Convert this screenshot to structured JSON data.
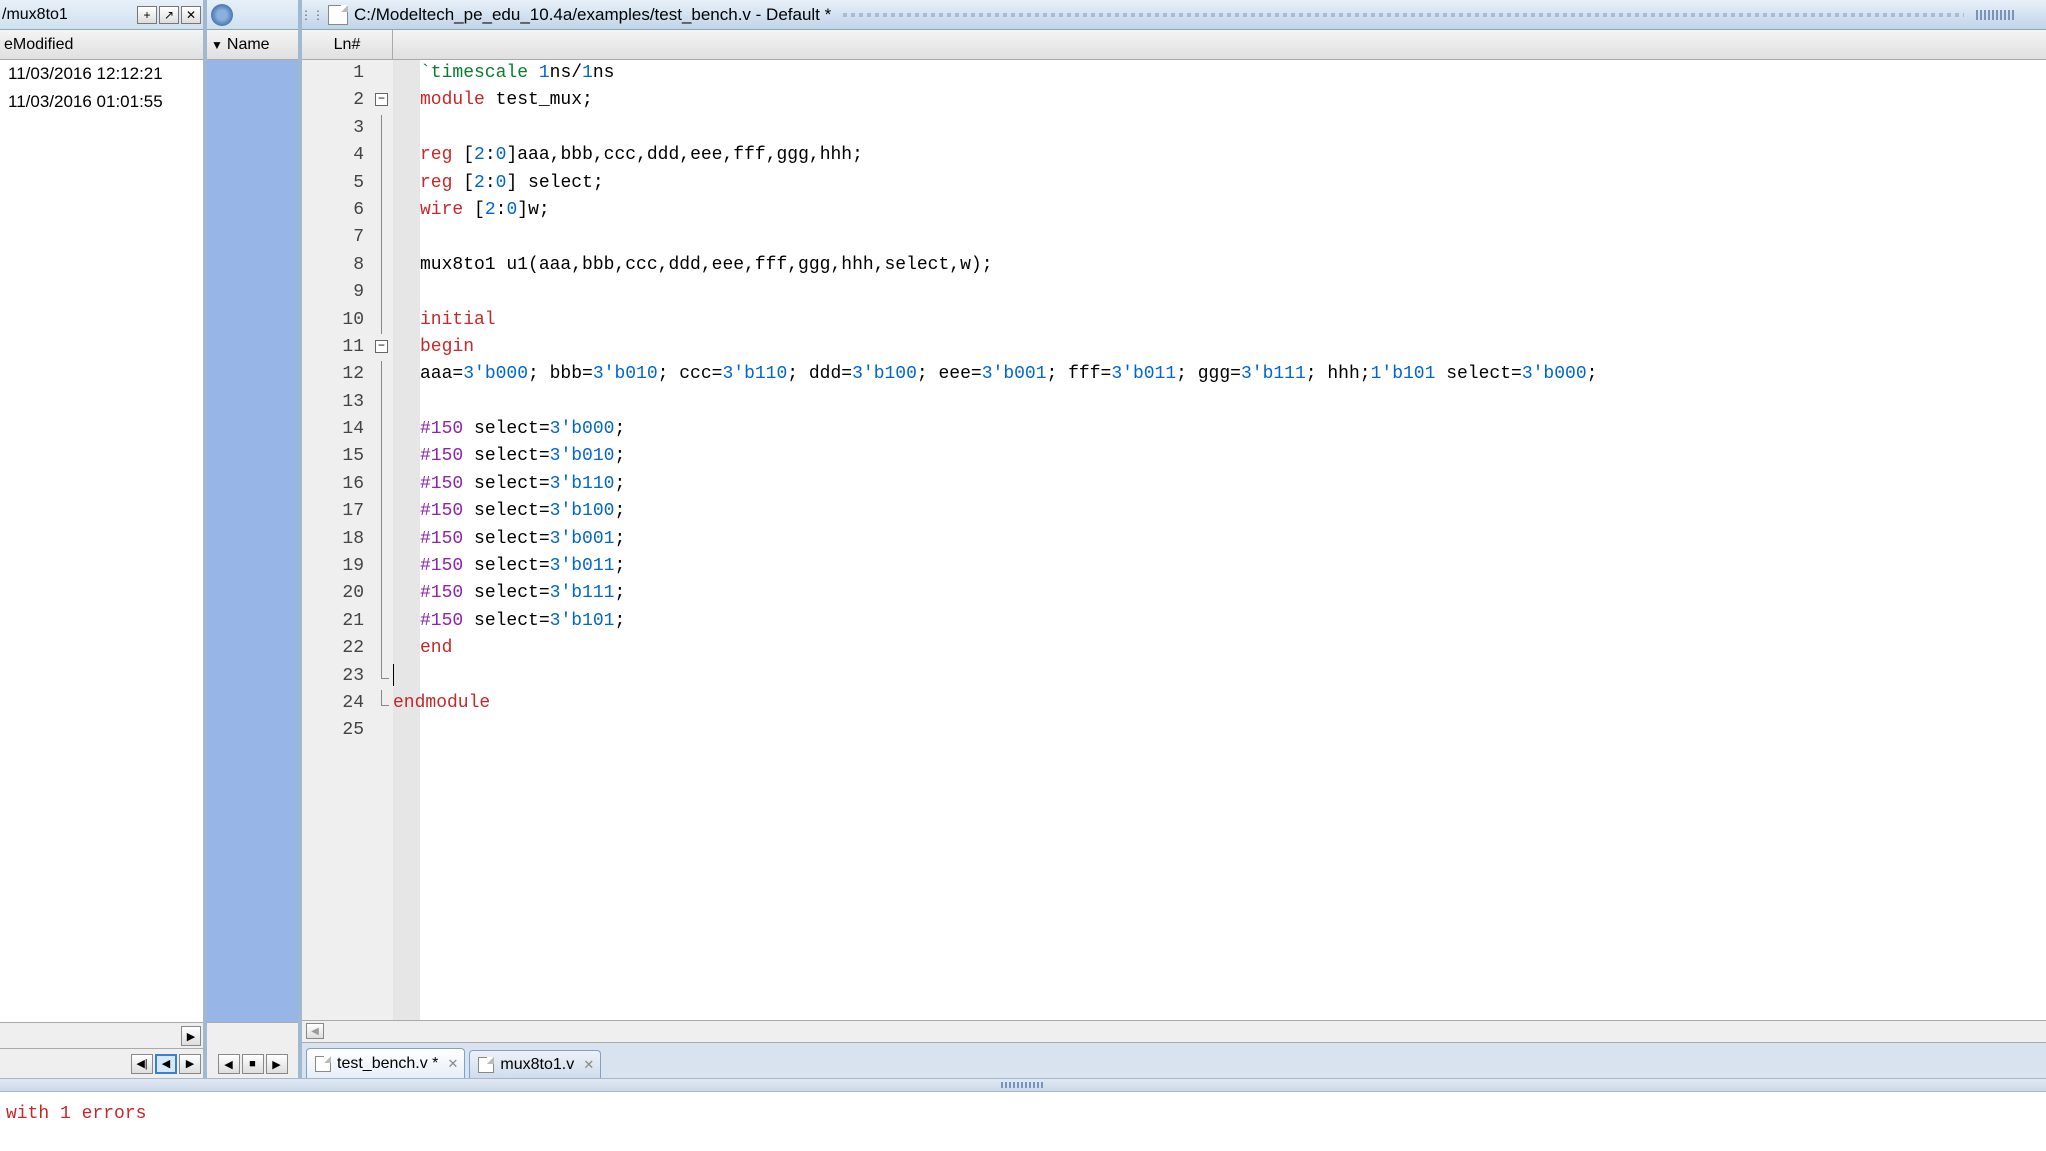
{
  "left_panel": {
    "title": "/mux8to1",
    "header": "Modified",
    "rows": [
      "11/03/2016 12:12:21",
      "11/03/2016 01:01:55"
    ]
  },
  "mid_panel": {
    "header": "Name"
  },
  "editor": {
    "title": "C:/Modeltech_pe_edu_10.4a/examples/test_bench.v - Default *",
    "ln_header": "Ln#",
    "lines": [
      {
        "n": 1,
        "fold": null,
        "tokens": [
          [
            "grn",
            "`timescale"
          ],
          [
            "txt",
            " "
          ],
          [
            "num",
            "1"
          ],
          [
            "txt",
            "ns/"
          ],
          [
            "num",
            "1"
          ],
          [
            "txt",
            "ns"
          ]
        ]
      },
      {
        "n": 2,
        "fold": "-",
        "tokens": [
          [
            "kw",
            "module"
          ],
          [
            "txt",
            " test_mux;"
          ]
        ]
      },
      {
        "n": 3,
        "fold": "|",
        "tokens": []
      },
      {
        "n": 4,
        "fold": "|",
        "tokens": [
          [
            "kw",
            "reg"
          ],
          [
            "txt",
            " ["
          ],
          [
            "num",
            "2"
          ],
          [
            "txt",
            ":"
          ],
          [
            "num",
            "0"
          ],
          [
            "txt",
            "]aaa,bbb,ccc,ddd,eee,fff,ggg,hhh;"
          ]
        ]
      },
      {
        "n": 5,
        "fold": "|",
        "tokens": [
          [
            "kw",
            "reg"
          ],
          [
            "txt",
            " ["
          ],
          [
            "num",
            "2"
          ],
          [
            "txt",
            ":"
          ],
          [
            "num",
            "0"
          ],
          [
            "txt",
            "] select;"
          ]
        ]
      },
      {
        "n": 6,
        "fold": "|",
        "tokens": [
          [
            "kw",
            "wire"
          ],
          [
            "txt",
            " ["
          ],
          [
            "num",
            "2"
          ],
          [
            "txt",
            ":"
          ],
          [
            "num",
            "0"
          ],
          [
            "txt",
            "]w;"
          ]
        ]
      },
      {
        "n": 7,
        "fold": "|",
        "tokens": []
      },
      {
        "n": 8,
        "fold": "|",
        "tokens": [
          [
            "txt",
            "mux8to1 u1(aaa,bbb,ccc,ddd,eee,fff,ggg,hhh,select,w);"
          ]
        ]
      },
      {
        "n": 9,
        "fold": "|",
        "tokens": []
      },
      {
        "n": 10,
        "fold": "|",
        "tokens": [
          [
            "kw",
            "initial"
          ]
        ]
      },
      {
        "n": 11,
        "fold": "-",
        "tokens": [
          [
            "kw",
            "begin"
          ]
        ]
      },
      {
        "n": 12,
        "fold": "|",
        "tokens": [
          [
            "txt",
            "aaa="
          ],
          [
            "num",
            "3'b000"
          ],
          [
            "txt",
            "; bbb="
          ],
          [
            "num",
            "3'b010"
          ],
          [
            "txt",
            "; ccc="
          ],
          [
            "num",
            "3'b110"
          ],
          [
            "txt",
            "; ddd="
          ],
          [
            "num",
            "3'b100"
          ],
          [
            "txt",
            "; eee="
          ],
          [
            "num",
            "3'b001"
          ],
          [
            "txt",
            "; fff="
          ],
          [
            "num",
            "3'b011"
          ],
          [
            "txt",
            "; ggg="
          ],
          [
            "num",
            "3'b111"
          ],
          [
            "txt",
            "; hhh;"
          ],
          [
            "num",
            "1'b101"
          ],
          [
            "txt",
            " select="
          ],
          [
            "num",
            "3'b000"
          ],
          [
            "txt",
            ";"
          ]
        ]
      },
      {
        "n": 13,
        "fold": "|",
        "tokens": []
      },
      {
        "n": 14,
        "fold": "|",
        "tokens": [
          [
            "delay",
            "#150"
          ],
          [
            "txt",
            " select="
          ],
          [
            "num",
            "3'b000"
          ],
          [
            "txt",
            ";"
          ]
        ]
      },
      {
        "n": 15,
        "fold": "|",
        "tokens": [
          [
            "delay",
            "#150"
          ],
          [
            "txt",
            " select="
          ],
          [
            "num",
            "3'b010"
          ],
          [
            "txt",
            ";"
          ]
        ]
      },
      {
        "n": 16,
        "fold": "|",
        "tokens": [
          [
            "delay",
            "#150"
          ],
          [
            "txt",
            " select="
          ],
          [
            "num",
            "3'b110"
          ],
          [
            "txt",
            ";"
          ]
        ]
      },
      {
        "n": 17,
        "fold": "|",
        "tokens": [
          [
            "delay",
            "#150"
          ],
          [
            "txt",
            " select="
          ],
          [
            "num",
            "3'b100"
          ],
          [
            "txt",
            ";"
          ]
        ]
      },
      {
        "n": 18,
        "fold": "|",
        "tokens": [
          [
            "delay",
            "#150"
          ],
          [
            "txt",
            " select="
          ],
          [
            "num",
            "3'b001"
          ],
          [
            "txt",
            ";"
          ]
        ]
      },
      {
        "n": 19,
        "fold": "|",
        "tokens": [
          [
            "delay",
            "#150"
          ],
          [
            "txt",
            " select="
          ],
          [
            "num",
            "3'b011"
          ],
          [
            "txt",
            ";"
          ]
        ]
      },
      {
        "n": 20,
        "fold": "|",
        "tokens": [
          [
            "delay",
            "#150"
          ],
          [
            "txt",
            " select="
          ],
          [
            "num",
            "3'b111"
          ],
          [
            "txt",
            ";"
          ]
        ]
      },
      {
        "n": 21,
        "fold": "|",
        "tokens": [
          [
            "delay",
            "#150"
          ],
          [
            "txt",
            " select="
          ],
          [
            "num",
            "3'b101"
          ],
          [
            "txt",
            ";"
          ]
        ]
      },
      {
        "n": 22,
        "fold": "|",
        "tokens": [
          [
            "kw",
            "end"
          ]
        ]
      },
      {
        "n": 23,
        "fold": "L",
        "tokens": [
          [
            "txt",
            ""
          ]
        ],
        "cursor": true,
        "noindent": true
      },
      {
        "n": 24,
        "fold": "L2",
        "tokens": [
          [
            "kw",
            "endmodule"
          ]
        ],
        "noindent": true
      },
      {
        "n": 25,
        "fold": null,
        "tokens": []
      }
    ],
    "tabs": [
      {
        "label": "test_bench.v *",
        "active": true
      },
      {
        "label": "mux8to1.v",
        "active": false
      }
    ]
  },
  "console": {
    "text": "with 1 errors"
  }
}
